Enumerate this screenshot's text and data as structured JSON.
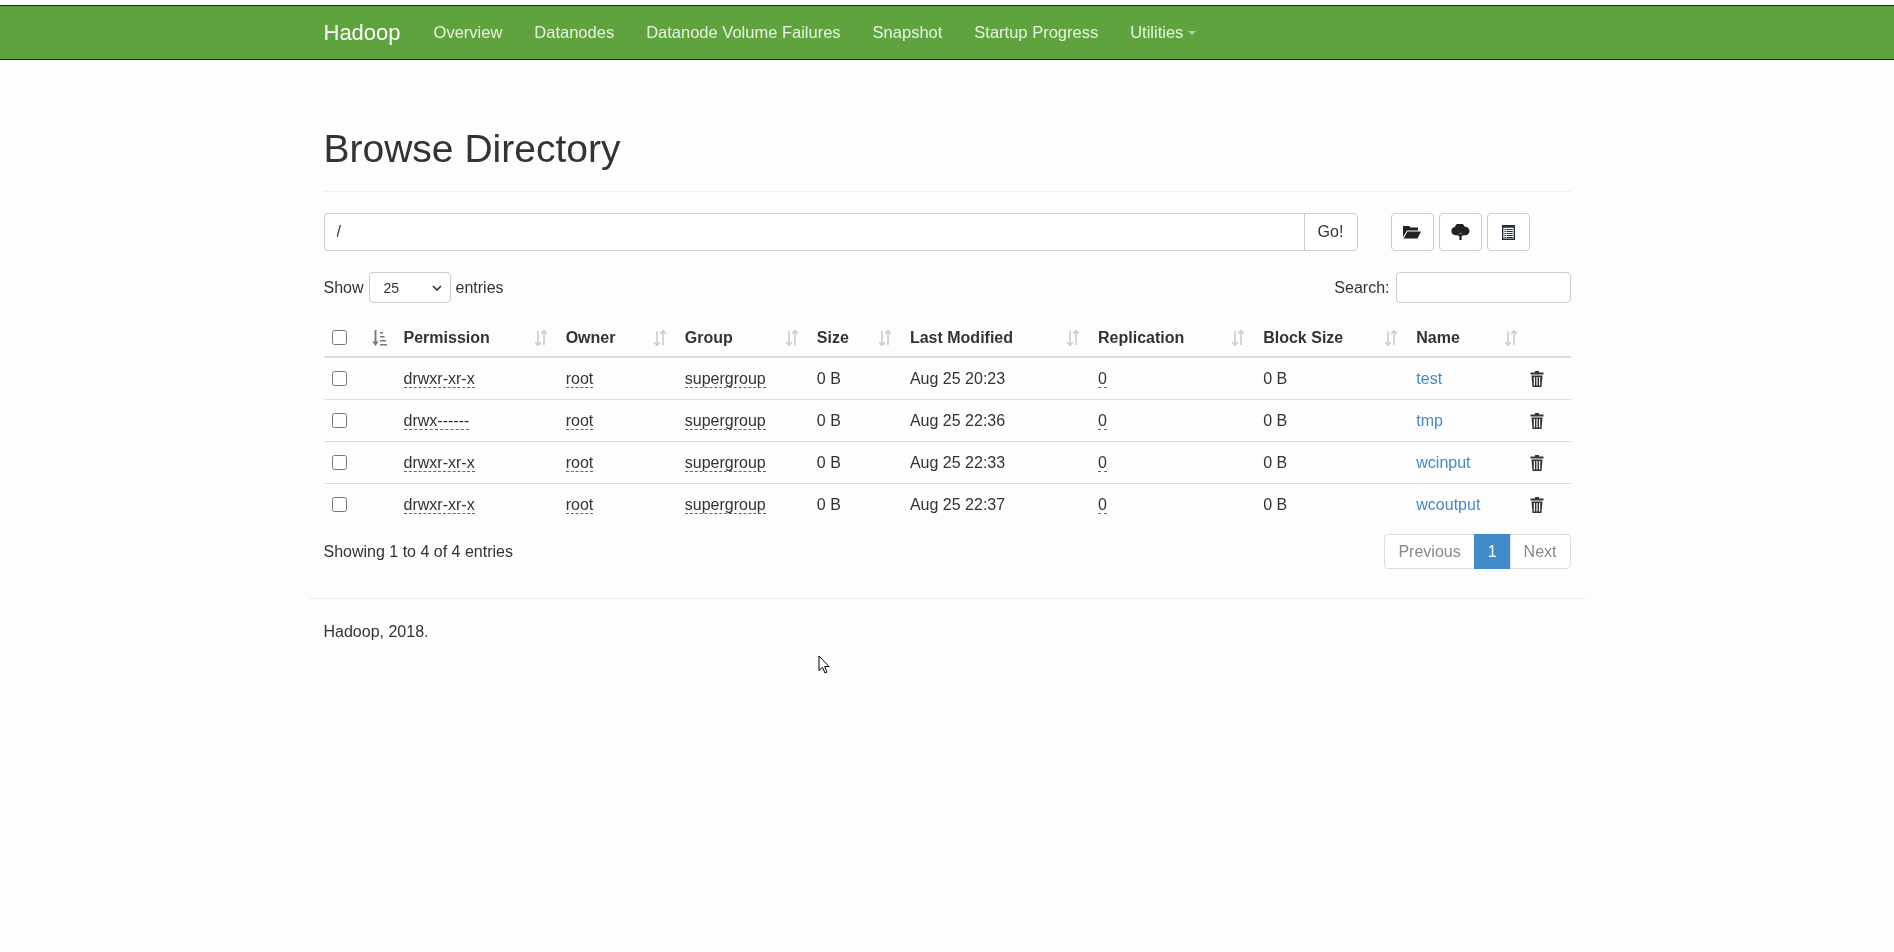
{
  "navbar": {
    "brand": "Hadoop",
    "items": [
      {
        "label": "Overview",
        "selected": false,
        "dropdown": false
      },
      {
        "label": "Datanodes",
        "selected": false,
        "dropdown": false
      },
      {
        "label": "Datanode Volume Failures",
        "selected": false,
        "dropdown": false
      },
      {
        "label": "Snapshot",
        "selected": false,
        "dropdown": false
      },
      {
        "label": "Startup Progress",
        "selected": false,
        "dropdown": false
      },
      {
        "label": "Utilities",
        "selected": false,
        "dropdown": true
      }
    ]
  },
  "page": {
    "title": "Browse Directory"
  },
  "path_bar": {
    "value": "/",
    "go": "Go!"
  },
  "length_menu": {
    "label_before": "Show",
    "value": "25",
    "label_after": "entries"
  },
  "search": {
    "label": "Search:"
  },
  "table": {
    "select_all": {
      "checked": false
    },
    "columns": [
      {
        "sorted": true
      },
      {
        "label": "Permission",
        "sorted": false
      },
      {
        "label": "Owner",
        "sorted": false
      },
      {
        "label": "Group",
        "sorted": false
      },
      {
        "label": "Size",
        "sorted": false
      },
      {
        "label": "Last Modified",
        "sorted": false
      },
      {
        "label": "Replication",
        "sorted": false
      },
      {
        "label": "Block Size",
        "sorted": false
      },
      {
        "label": "Name",
        "sorted": false
      }
    ],
    "rows": [
      {
        "checked": false,
        "permission": "drwxr-xr-x",
        "owner": "root",
        "group": "supergroup",
        "size": "0 B",
        "last_modified": "Aug 25 20:23",
        "replication": "0",
        "block_size": "0 B",
        "name": "test"
      },
      {
        "checked": false,
        "permission": "drwx------",
        "owner": "root",
        "group": "supergroup",
        "size": "0 B",
        "last_modified": "Aug 25 22:36",
        "replication": "0",
        "block_size": "0 B",
        "name": "tmp"
      },
      {
        "checked": false,
        "permission": "drwxr-xr-x",
        "owner": "root",
        "group": "supergroup",
        "size": "0 B",
        "last_modified": "Aug 25 22:33",
        "replication": "0",
        "block_size": "0 B",
        "name": "wcinput"
      },
      {
        "checked": false,
        "permission": "drwxr-xr-x",
        "owner": "root",
        "group": "supergroup",
        "size": "0 B",
        "last_modified": "Aug 25 22:37",
        "replication": "0",
        "block_size": "0 B",
        "name": "wcoutput"
      }
    ]
  },
  "info": "Showing 1 to 4 of 4 entries",
  "pagination": {
    "previous": {
      "label": "Previous",
      "disabled": true
    },
    "pages": [
      {
        "label": "1",
        "selected": true
      }
    ],
    "next": {
      "label": "Next",
      "disabled": true
    }
  },
  "footer": "Hadoop, 2018."
}
